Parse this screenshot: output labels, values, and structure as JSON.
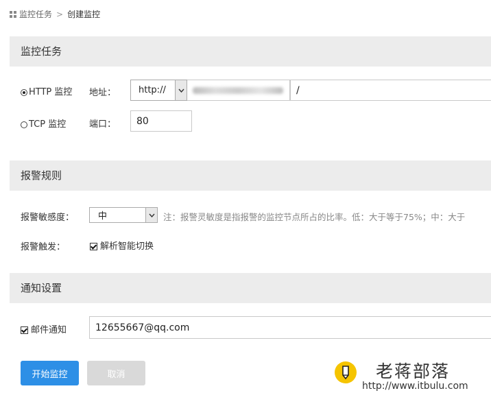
{
  "breadcrumb": {
    "parent": "监控任务",
    "separator": ">",
    "current": "创建监控"
  },
  "sections": {
    "task": {
      "title": "监控任务"
    },
    "alert": {
      "title": "报警规则"
    },
    "notify": {
      "title": "通知设置"
    }
  },
  "task": {
    "http_radio_label": "HTTP 监控",
    "tcp_radio_label": "TCP 监控",
    "address_label": "地址：",
    "protocol_value": "http://",
    "path_value": "/",
    "port_label": "端口：",
    "port_value": "80",
    "selected": "HTTP"
  },
  "alert": {
    "sensitivity_label": "报警敏感度：",
    "sensitivity_value": "中",
    "note": "注：报警灵敏度是指报警的监控节点所占的比率。低：大于等于75%；中：大于",
    "trigger_label": "报警触发：",
    "trigger_option": "解析智能切换",
    "trigger_checked": true
  },
  "notify": {
    "email_label": "邮件通知",
    "email_checked": true,
    "email_value": "12655667@qq.com"
  },
  "actions": {
    "start_label": "开始监控",
    "cancel_label": "取消"
  },
  "watermark": {
    "title": "老蒋部落",
    "url": "http://www.itbulu.com"
  },
  "colors": {
    "primary": "#2d8fe6",
    "section_bg": "#ececec",
    "logo": "#f5c400"
  }
}
